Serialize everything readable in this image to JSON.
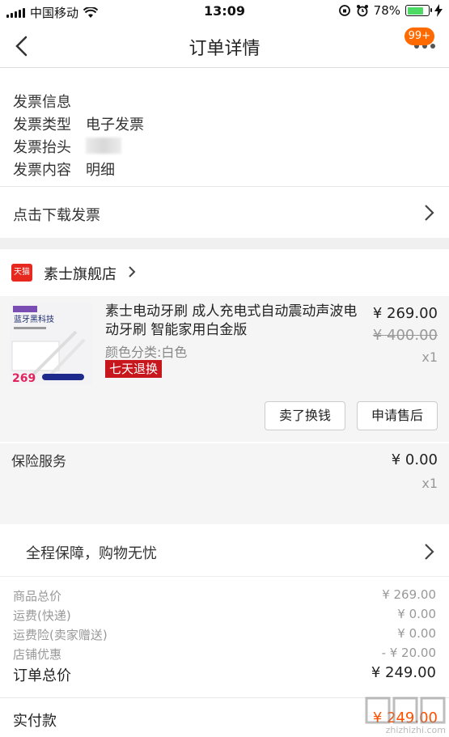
{
  "status_bar": {
    "carrier": "中国移动",
    "time": "13:09",
    "battery_percent": "78%",
    "battery_level": 0.78
  },
  "nav": {
    "title": "订单详情",
    "badge": "99+"
  },
  "invoice": {
    "heading": "发票信息",
    "rows": [
      {
        "label": "发票类型",
        "value": "电子发票"
      },
      {
        "label": "发票抬头",
        "value": ""
      },
      {
        "label": "发票内容",
        "value": "明细"
      }
    ],
    "download_label": "点击下载发票"
  },
  "shop": {
    "badge": "天猫",
    "name": "素士旗舰店"
  },
  "product": {
    "thumb_text": "蓝牙黑科技",
    "thumb_price": "269",
    "title": "素士电动牙刷 成人充电式自动震动声波电动牙刷 智能家用白金版",
    "variant": "颜色分类:白色",
    "return_badge": "七天退换",
    "price": "¥ 269.00",
    "original_price": "¥ 400.00",
    "quantity": "x1",
    "sell_button": "卖了换钱",
    "aftersale_button": "申请售后"
  },
  "insurance": {
    "label": "保险服务",
    "price": "¥ 0.00",
    "quantity": "x1"
  },
  "guarantee": {
    "label": "全程保障，购物无忧"
  },
  "summary": {
    "rows": [
      {
        "label": "商品总价",
        "value": "¥ 269.00"
      },
      {
        "label": "运费(快递)",
        "value": "¥ 0.00"
      },
      {
        "label": "运费险(卖家赠送)",
        "value": "¥ 0.00"
      },
      {
        "label": "店铺优惠",
        "value": "- ¥ 20.00"
      }
    ],
    "total_label": "订单总价",
    "total_value": "¥ 249.00",
    "paid_label": "实付款",
    "paid_value": "¥ 249.00"
  },
  "watermark": "zhizhizhi.com",
  "colors": {
    "accent_orange": "#ff5000",
    "tmall_red": "#e6281e",
    "return_badge": "#c8161d",
    "battery_green": "#4cd964"
  }
}
